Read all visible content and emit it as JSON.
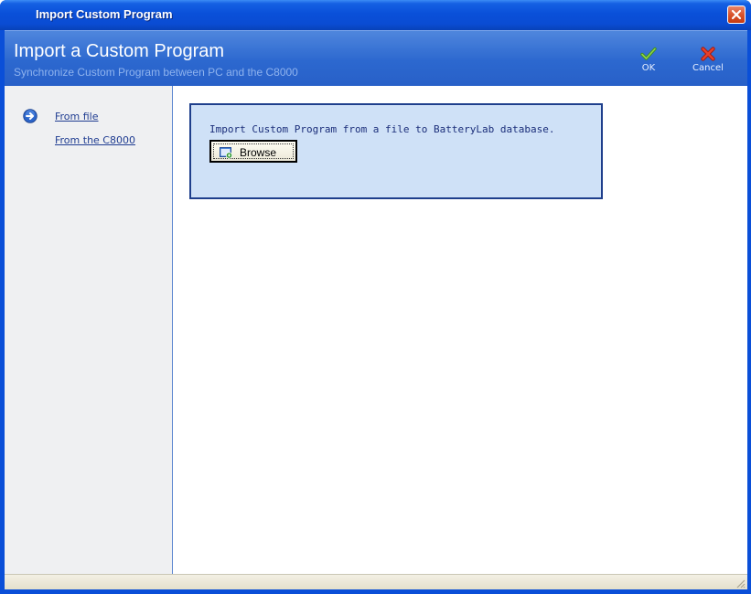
{
  "window": {
    "title": "Import Custom Program"
  },
  "header": {
    "title": "Import a Custom Program",
    "subtitle": "Synchronize Custom Program between PC and the C8000",
    "ok_label": "OK",
    "cancel_label": "Cancel"
  },
  "sidebar": {
    "items": [
      {
        "label": "From file",
        "selected": true,
        "icon": "arrow-right-circle-icon"
      },
      {
        "label": "From the C8000",
        "selected": false
      }
    ]
  },
  "main": {
    "panel_text": "Import Custom Program from a file to BatteryLab database.",
    "browse_label": "Browse"
  },
  "colors": {
    "titlebar": "#0a50d9",
    "header": "#2c68cf",
    "panel_bg": "#cfe1f7",
    "panel_border": "#1f3f8c",
    "link": "#1f3c91"
  }
}
